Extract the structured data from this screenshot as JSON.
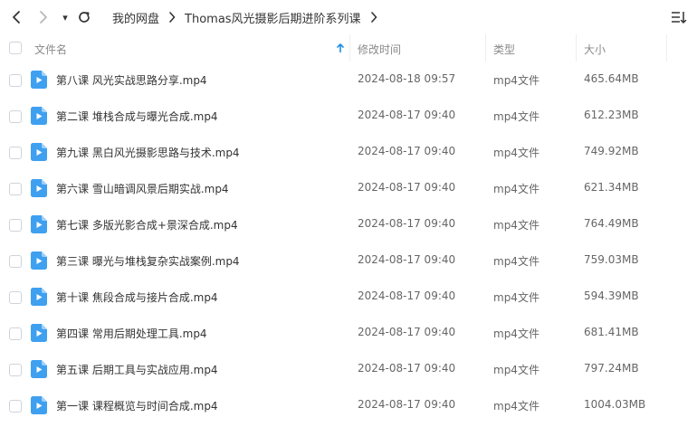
{
  "nav": {
    "dropdown_glyph": "▾"
  },
  "breadcrumb": [
    {
      "label": "我的网盘"
    },
    {
      "label": "Thomas风光摄影后期进阶系列课"
    }
  ],
  "columns": {
    "name": "文件名",
    "modified": "修改时间",
    "type": "类型",
    "size": "大小"
  },
  "colors": {
    "accent": "#1e8ee6",
    "icon_blue": "#3fa0f0"
  },
  "files": [
    {
      "name": "第八课 风光实战思路分享.mp4",
      "modified": "2024-08-18 09:57",
      "type": "mp4文件",
      "size": "465.64MB"
    },
    {
      "name": "第二课 堆栈合成与曝光合成.mp4",
      "modified": "2024-08-17 09:40",
      "type": "mp4文件",
      "size": "612.23MB"
    },
    {
      "name": "第九课 黑白风光摄影思路与技术.mp4",
      "modified": "2024-08-17 09:40",
      "type": "mp4文件",
      "size": "749.92MB"
    },
    {
      "name": "第六课 雪山暗调风景后期实战.mp4",
      "modified": "2024-08-17 09:40",
      "type": "mp4文件",
      "size": "621.34MB"
    },
    {
      "name": "第七课 多版光影合成+景深合成.mp4",
      "modified": "2024-08-17 09:40",
      "type": "mp4文件",
      "size": "764.49MB"
    },
    {
      "name": "第三课 曝光与堆栈复杂实战案例.mp4",
      "modified": "2024-08-17 09:40",
      "type": "mp4文件",
      "size": "759.03MB"
    },
    {
      "name": "第十课 焦段合成与接片合成.mp4",
      "modified": "2024-08-17 09:40",
      "type": "mp4文件",
      "size": "594.39MB"
    },
    {
      "name": "第四课 常用后期处理工具.mp4",
      "modified": "2024-08-17 09:40",
      "type": "mp4文件",
      "size": "681.41MB"
    },
    {
      "name": "第五课 后期工具与实战应用.mp4",
      "modified": "2024-08-17 09:40",
      "type": "mp4文件",
      "size": "797.24MB"
    },
    {
      "name": "第一课 课程概览与时间合成.mp4",
      "modified": "2024-08-17 09:40",
      "type": "mp4文件",
      "size": "1004.03MB"
    }
  ]
}
